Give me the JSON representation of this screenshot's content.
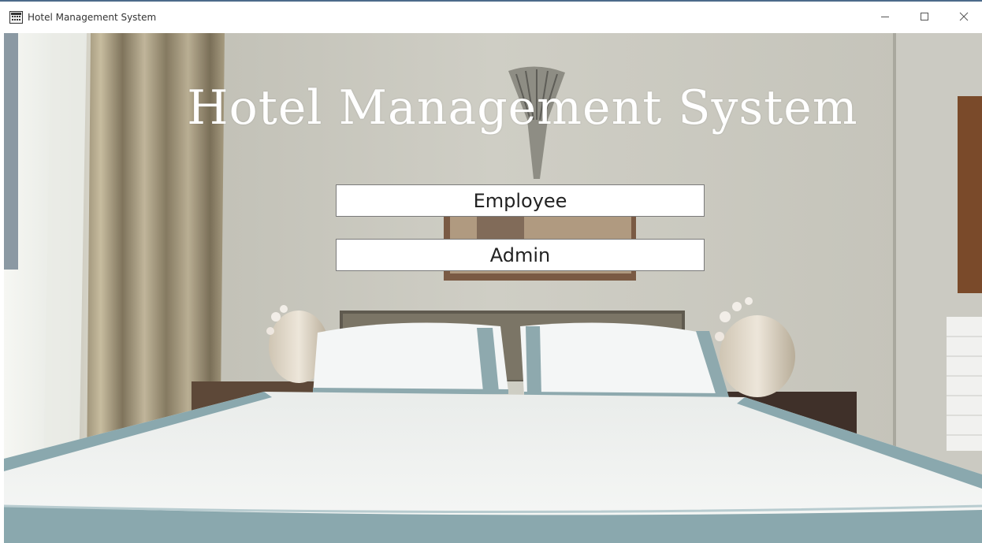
{
  "window": {
    "title": "Hotel Management System",
    "icon": "hotel-building-icon",
    "controls": {
      "minimize_icon": "minimize-icon",
      "maximize_icon": "maximize-icon",
      "close_icon": "close-icon"
    }
  },
  "main": {
    "heading": "Hotel Management System",
    "buttons": {
      "employee_label": "Employee",
      "admin_label": "Admin"
    },
    "background": "hotel-bedroom-photo"
  },
  "colors": {
    "heading_text": "#ffffff",
    "button_bg": "#ffffff",
    "button_text": "#222222",
    "titlebar_bg": "#ffffff"
  }
}
